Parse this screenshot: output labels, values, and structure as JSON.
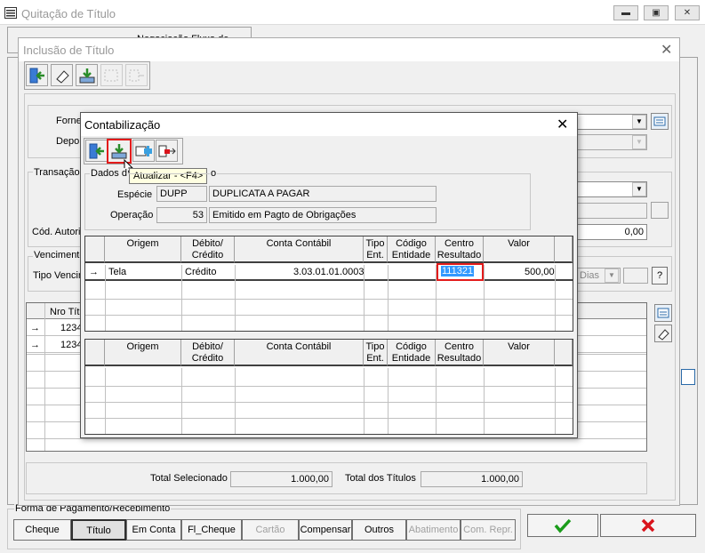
{
  "main_window": {
    "title": "Quitação de Título",
    "labels": {
      "fornecedor": "Forne",
      "deposito": "Depo",
      "transacao": "Transação",
      "cod_autoriz": "Cód. Autoriz",
      "vencimento": "Vencimento",
      "tipo_venc": "Tipo Vencir",
      "nro_titulo": "Nro Títi",
      "dias": "Dias",
      "question": "?"
    },
    "valor_field": "0,00",
    "toolbar_partial": "Negociação Fluxo de",
    "grid_rows": [
      {
        "nro": "1234"
      },
      {
        "nro": "1234"
      }
    ],
    "totals": {
      "selecionado_label": "Total Selecionado",
      "selecionado_value": "1.000,00",
      "titulos_label": "Total dos Títulos",
      "titulos_value": "1.000,00"
    },
    "payment_group_label": "Forma de Pagamento/Recebimento",
    "payment_tabs": [
      {
        "label": "Cheque",
        "enabled": true
      },
      {
        "label": "Título",
        "enabled": true
      },
      {
        "label": "Em Conta",
        "enabled": true
      },
      {
        "label": "Fl_Cheque",
        "enabled": true
      },
      {
        "label": "Cartão",
        "enabled": false
      },
      {
        "label": "Compensar",
        "enabled": true
      },
      {
        "label": "Outros",
        "enabled": true
      },
      {
        "label": "Abatimento",
        "enabled": false
      },
      {
        "label": "Com. Repr.",
        "enabled": false
      }
    ]
  },
  "inclusao_dialog": {
    "title": "Inclusão de Título"
  },
  "contab_dialog": {
    "title": "Contabilização",
    "tooltip": "Atualizar - <F4>",
    "dados_label": "Dados d",
    "dados_label_tail": "o",
    "especie_label": "Espécie",
    "especie_code": "DUPP",
    "especie_desc": "DUPLICATA A PAGAR",
    "operacao_label": "Operação",
    "operacao_code": "53",
    "operacao_desc": "Emitido em Pagto de Obrigações",
    "columns": [
      "Origem",
      "Débito/ Crédito",
      "Conta Contábil",
      "Tipo Ent.",
      "Código Entidade",
      "Centro Resultado",
      "Valor"
    ],
    "rows": [
      {
        "origem": "Tela",
        "debcred": "Crédito",
        "conta": "3.03.01.01.0003",
        "tipo": "",
        "codigo": "",
        "centro": "111321",
        "valor": "500,00"
      }
    ]
  },
  "colors": {
    "accent_red": "#e31b1b",
    "selection_blue": "#3399ff",
    "ok_green": "#1a9c1a",
    "cancel_red": "#d9131b"
  }
}
